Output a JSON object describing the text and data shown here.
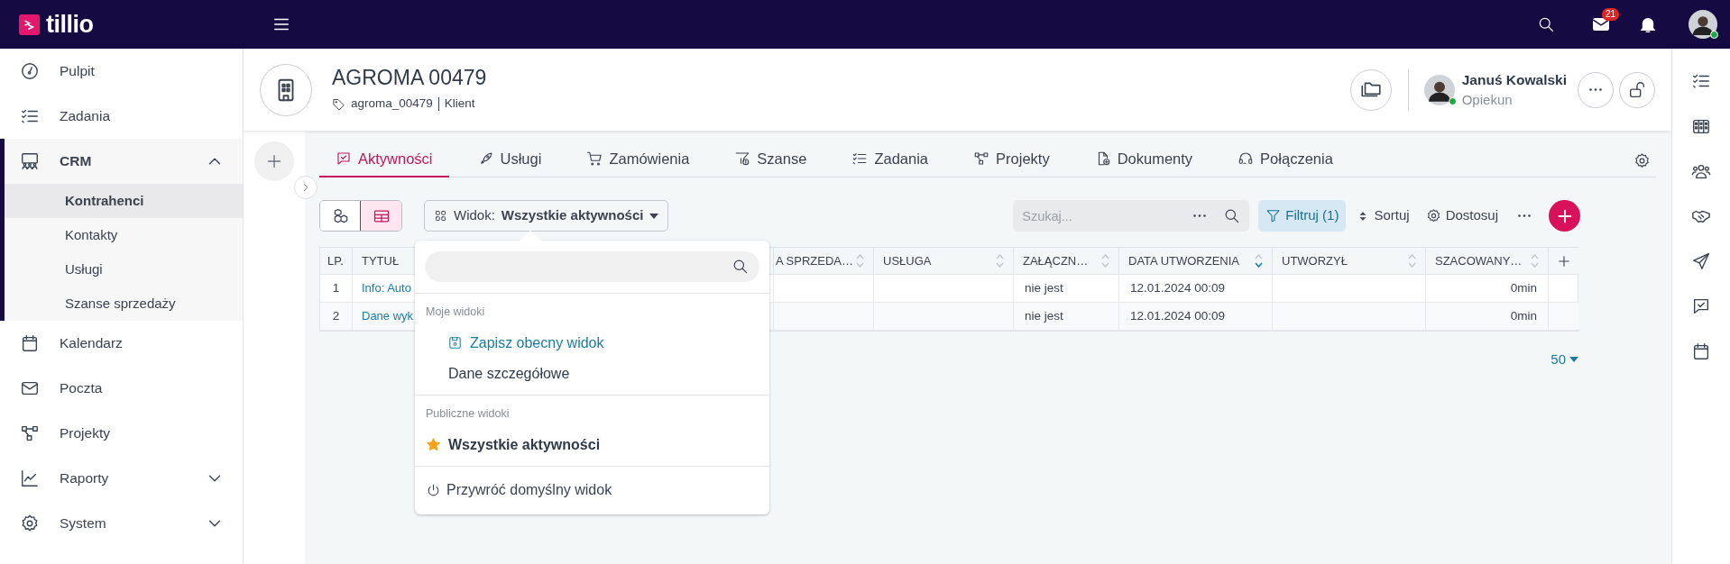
{
  "topbar": {
    "logo": "tillio",
    "mail_badge": "21"
  },
  "sidebar": {
    "items": [
      {
        "label": "Pulpit",
        "selected": false
      },
      {
        "label": "Zadania",
        "selected": false
      },
      {
        "label": "CRM",
        "selected": true,
        "expanded": true,
        "children": [
          {
            "label": "Kontrahenci",
            "selected": true
          },
          {
            "label": "Kontakty",
            "selected": false
          },
          {
            "label": "Usługi",
            "selected": false
          },
          {
            "label": "Szanse sprzedaży",
            "selected": false
          }
        ]
      },
      {
        "label": "Kalendarz",
        "selected": false
      },
      {
        "label": "Poczta",
        "selected": false
      },
      {
        "label": "Projekty",
        "selected": false
      },
      {
        "label": "Raporty",
        "selected": false,
        "expanded": false
      },
      {
        "label": "System",
        "selected": false,
        "expanded": false
      }
    ]
  },
  "header": {
    "title": "AGROMA 00479",
    "tag": "agroma_00479",
    "type": "Klient",
    "owner": {
      "name": "Januś Kowalski",
      "role": "Opiekun",
      "online": true
    }
  },
  "tabs": [
    {
      "label": "Aktywności",
      "selected": true
    },
    {
      "label": "Usługi",
      "selected": false
    },
    {
      "label": "Zamówienia",
      "selected": false
    },
    {
      "label": "Szanse",
      "selected": false
    },
    {
      "label": "Zadania",
      "selected": false
    },
    {
      "label": "Projekty",
      "selected": false
    },
    {
      "label": "Dokumenty",
      "selected": false
    },
    {
      "label": "Połączenia",
      "selected": false
    }
  ],
  "toolbar": {
    "view_modes": [
      {
        "selected": false
      },
      {
        "selected": true
      }
    ],
    "view_button": {
      "prefix": "Widok:",
      "value": "Wszystkie aktywności"
    },
    "search": {
      "placeholder": "Szukaj..."
    },
    "filter": {
      "label": "Filtruj (1)",
      "active": true
    },
    "sort": "Sortuj",
    "customize": "Dostosuj"
  },
  "table": {
    "columns": [
      {
        "label": "LP."
      },
      {
        "label": "TYTUŁ"
      },
      {
        "label": "A SPRZEDA…",
        "sorted": false
      },
      {
        "label": "USŁUGA",
        "sorted": false
      },
      {
        "label": "ZAŁĄCZN…",
        "sorted": false
      },
      {
        "label": "DATA UTWORZENIA",
        "sorted": true
      },
      {
        "label": "UTWORZYŁ",
        "sorted": false
      },
      {
        "label": "SZACOWANY…",
        "sorted": false
      }
    ],
    "rows": [
      {
        "lp": "1",
        "title": "Info: Auto",
        "attachments": "nie jest",
        "created": "12.01.2024 00:09",
        "estimate": "0min"
      },
      {
        "lp": "2",
        "title": "Dane wyk",
        "attachments": "nie jest",
        "created": "12.01.2024 00:09",
        "estimate": "0min"
      }
    ],
    "page_size": "50"
  },
  "view_menu": {
    "sections": [
      {
        "heading": "Moje widoki",
        "items": [
          {
            "kind": "action",
            "label": "Zapisz obecny widok"
          },
          {
            "kind": "view",
            "label": "Dane szczegółowe",
            "selected": false,
            "favorite": false
          }
        ]
      },
      {
        "heading": "Publiczne widoki",
        "items": [
          {
            "kind": "view",
            "label": "Wszystkie aktywności",
            "selected": true,
            "favorite": true
          }
        ]
      }
    ],
    "reset": "Przywróć domyślny widok"
  }
}
